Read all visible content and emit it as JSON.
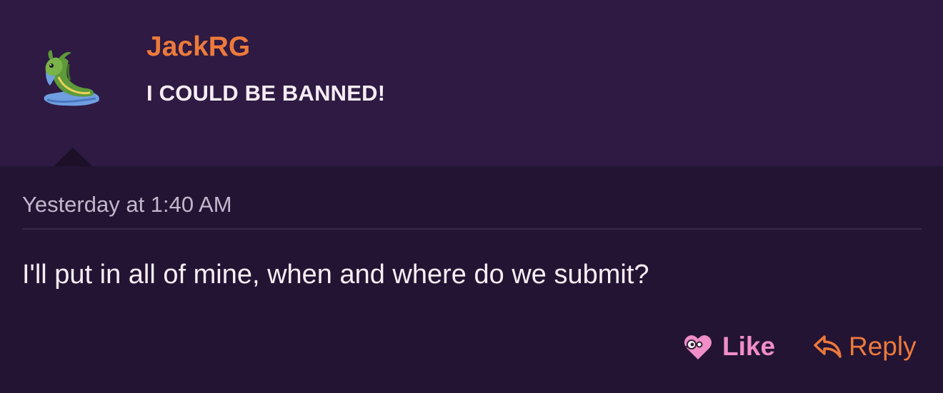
{
  "post": {
    "username": "JackRG",
    "user_title": "I COULD BE BANNED!",
    "timestamp": "Yesterday at 1:40 AM",
    "message": "I'll put in all of mine, when and where do we submit?",
    "avatar_icon": "gastrodon-sprite",
    "actions": {
      "like_label": "Like",
      "like_icon": "heart-face-icon",
      "reply_label": "Reply",
      "reply_icon": "reply-arrow-icon"
    }
  },
  "colors": {
    "header_bg": "#2e1a42",
    "body_bg": "#231433",
    "username": "#ec7a3c",
    "like": "#f08ec8",
    "reply": "#ec7a3c",
    "text": "#f8eef5",
    "muted": "#c2b6cc"
  }
}
